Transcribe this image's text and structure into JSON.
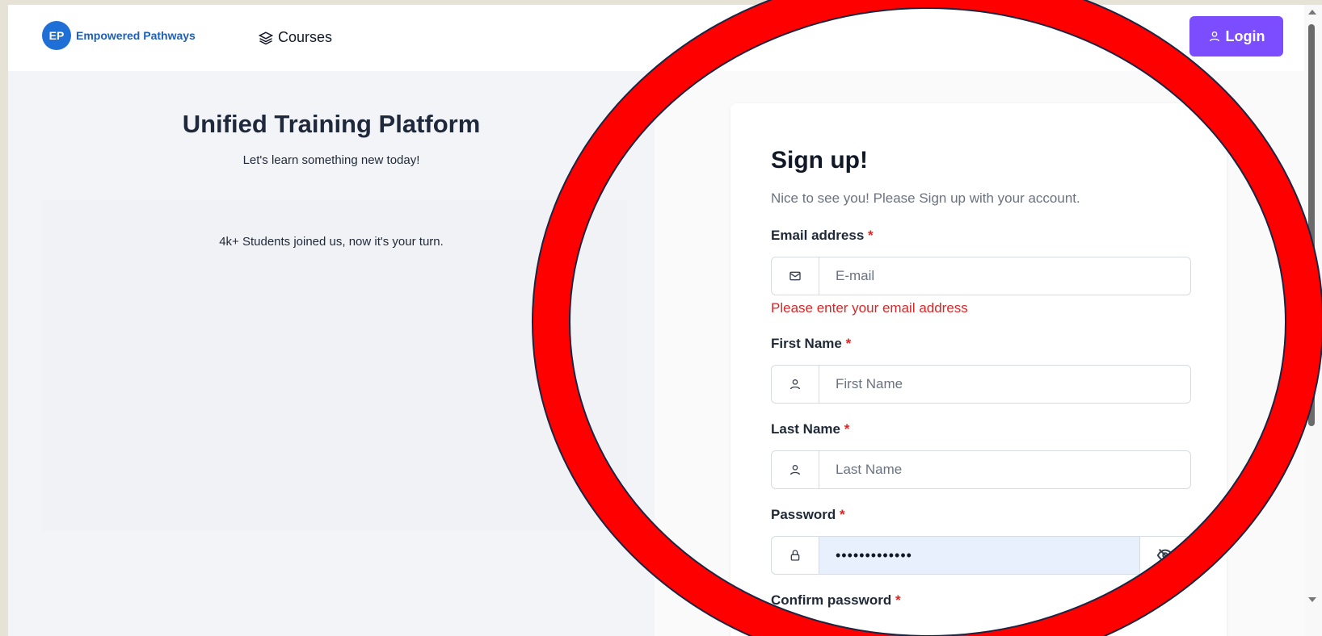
{
  "nav": {
    "logo_initials": "EP",
    "logo_text": "Empowered Pathways",
    "courses_label": "Courses",
    "login_label": "Login"
  },
  "left": {
    "title": "Unified Training Platform",
    "subtitle": "Let's learn something new today!",
    "students_text": "4k+ Students joined us, now it's your turn."
  },
  "form": {
    "title": "Sign up!",
    "subtitle": "Nice to see you! Please Sign up with your account.",
    "required_mark": "*",
    "email_label": "Email address",
    "email_placeholder": "E-mail",
    "email_error": "Please enter your email address",
    "first_name_label": "First Name",
    "first_name_placeholder": "First Name",
    "last_name_label": "Last Name",
    "last_name_placeholder": "Last Name",
    "password_label": "Password",
    "password_value": "•••••••••••••",
    "confirm_label": "Confirm password"
  },
  "colors": {
    "accent": "#7c4dff",
    "brand": "#1f6fd6",
    "error": "#dc2626",
    "annotation": "#ff0000"
  },
  "icons": [
    "layers-icon",
    "user-icon",
    "mail-icon",
    "lock-icon",
    "eye-off-icon",
    "scroll-up-icon",
    "scroll-down-icon"
  ]
}
